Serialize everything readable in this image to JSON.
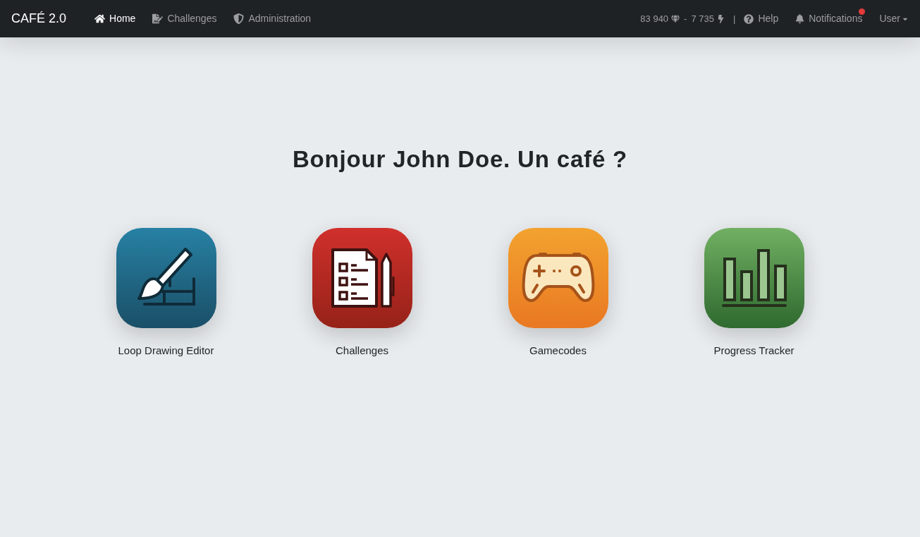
{
  "navbar": {
    "brand": "CAFÉ 2.0",
    "links": [
      {
        "label": "Home",
        "kind": "home",
        "selected": true
      },
      {
        "label": "Challenges",
        "kind": "document",
        "selected": false
      },
      {
        "label": "Administration",
        "kind": "admin",
        "selected": false
      }
    ],
    "gems": "83 940",
    "separator": "-",
    "energy": "7 735",
    "divider": "|",
    "help": "Help",
    "notifications": {
      "label": "Notifications",
      "unread": true
    },
    "user": "User"
  },
  "greeting": "Bonjour John Doe. Un café ?",
  "apps": [
    {
      "label": "Loop Drawing Editor",
      "kind": "brush"
    },
    {
      "label": "Challenges",
      "kind": "checklist"
    },
    {
      "label": "Gamecodes",
      "kind": "gamepad"
    },
    {
      "label": "Progress Tracker",
      "kind": "chart"
    }
  ]
}
